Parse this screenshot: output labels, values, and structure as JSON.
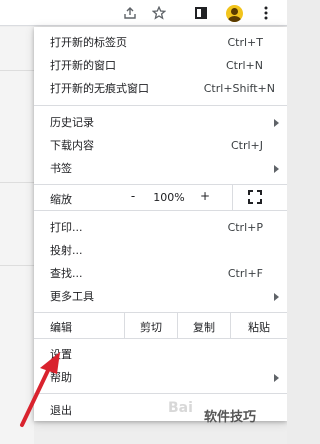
{
  "toolbar": {
    "icons": [
      "share-icon",
      "star-icon",
      "side-panel-icon",
      "profile-avatar-icon",
      "more-vert-icon"
    ]
  },
  "menu": {
    "items_group1": [
      {
        "label": "打开新的标签页",
        "shortcut": "Ctrl+T"
      },
      {
        "label": "打开新的窗口",
        "shortcut": "Ctrl+N"
      },
      {
        "label": "打开新的无痕式窗口",
        "shortcut": "Ctrl+Shift+N"
      }
    ],
    "items_group2": [
      {
        "label": "历史记录",
        "shortcut": "",
        "submenu": true
      },
      {
        "label": "下载内容",
        "shortcut": "Ctrl+J"
      },
      {
        "label": "书签",
        "shortcut": "",
        "submenu": true
      }
    ],
    "zoom": {
      "label": "缩放",
      "minus": "-",
      "value": "100%",
      "plus": "+"
    },
    "items_group3": [
      {
        "label": "打印...",
        "shortcut": "Ctrl+P"
      },
      {
        "label": "投射...",
        "shortcut": ""
      },
      {
        "label": "查找...",
        "shortcut": "Ctrl+F"
      },
      {
        "label": "更多工具",
        "shortcut": "",
        "submenu": true
      }
    ],
    "edit": {
      "label": "编辑",
      "cut": "剪切",
      "copy": "复制",
      "paste": "粘贴"
    },
    "items_group4": [
      {
        "label": "设置",
        "shortcut": ""
      },
      {
        "label": "帮助",
        "shortcut": "",
        "submenu": true
      }
    ],
    "exit": {
      "label": "退出"
    }
  },
  "watermark": {
    "logo": "Bai",
    "text": "软件技巧"
  },
  "annotation": {
    "arrow_color": "#d9232e"
  }
}
